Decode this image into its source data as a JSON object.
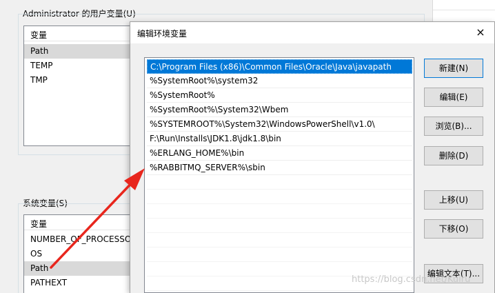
{
  "bg_window": {
    "user_group_label": "Administrator 的用户变量(U)",
    "user_header": "变量",
    "user_rows": [
      "Path",
      "TEMP",
      "TMP"
    ],
    "system_group_label": "系统变量(S)",
    "system_header": "变量",
    "system_rows": [
      "NUMBER_OF_PROCESSO",
      "OS",
      "Path",
      "PATHEXT"
    ]
  },
  "dialog": {
    "title": "编辑环境变量",
    "close_icon": "×",
    "paths": [
      "C:\\Program Files (x86)\\Common Files\\Oracle\\Java\\javapath",
      "%SystemRoot%\\system32",
      "%SystemRoot%",
      "%SystemRoot%\\System32\\Wbem",
      "%SYSTEMROOT%\\System32\\WindowsPowerShell\\v1.0\\",
      "F:\\Run\\Installs\\JDK1.8\\jdk1.8\\bin",
      "%ERLANG_HOME%\\bin",
      "%RABBITMQ_SERVER%\\sbin"
    ],
    "buttons": {
      "new": "新建(N)",
      "edit": "编辑(E)",
      "browse": "浏览(B)...",
      "delete": "删除(D)",
      "move_up": "上移(U)",
      "move_down": "下移(O)",
      "edit_text": "编辑文本(T)..."
    }
  },
  "annotation": {
    "arrow_color": "#e8261d"
  },
  "watermark": "https://blog.csdn.net/Kuiru"
}
